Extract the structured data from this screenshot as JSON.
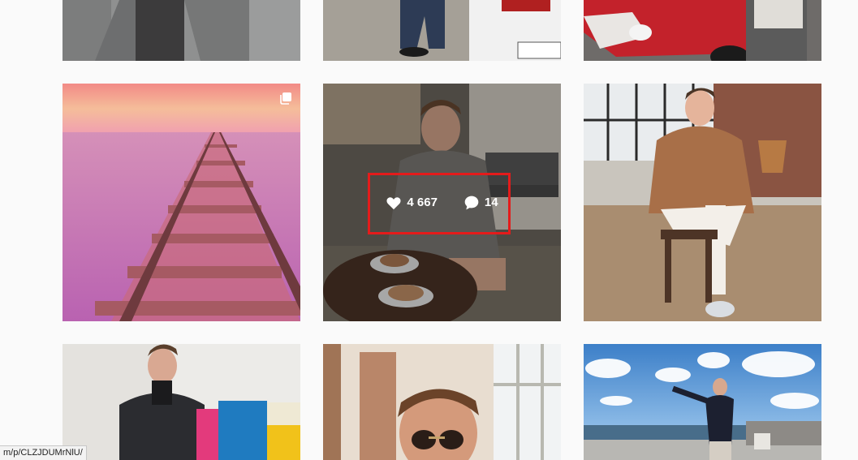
{
  "grid": {
    "highlighted_post": {
      "likes": "4 667",
      "comments": "14"
    }
  },
  "status_bar": {
    "url": "m/p/CLZJDUMrNlU/"
  },
  "icons": {
    "like": "heart-icon",
    "comment": "comment-bubble-icon",
    "multi": "carousel-icon"
  },
  "colors": {
    "highlight": "#e41b1b",
    "background": "#fafafa"
  }
}
